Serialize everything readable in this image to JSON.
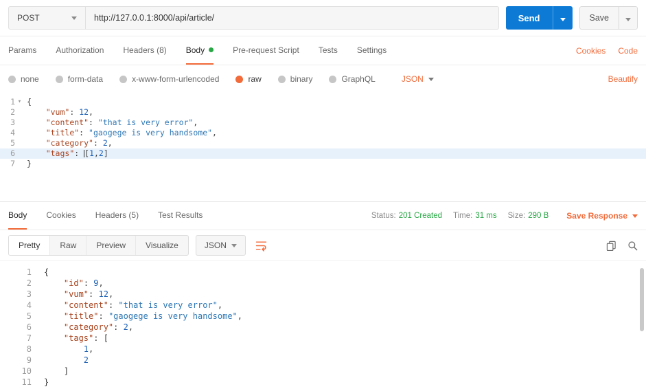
{
  "colors": {
    "orange": "#F26B3A",
    "blue": "#0D7BD6",
    "green": "#28A745"
  },
  "request": {
    "method": "POST",
    "url": "http://127.0.0.1:8000/api/article/",
    "send_label": "Send",
    "save_label": "Save",
    "tabs": [
      {
        "label": "Params"
      },
      {
        "label": "Authorization"
      },
      {
        "label": "Headers (8)"
      },
      {
        "label": "Body"
      },
      {
        "label": "Pre-request Script"
      },
      {
        "label": "Tests"
      },
      {
        "label": "Settings"
      }
    ],
    "links": {
      "cookies": "Cookies",
      "code": "Code"
    },
    "body_types": [
      {
        "label": "none"
      },
      {
        "label": "form-data"
      },
      {
        "label": "x-www-form-urlencoded"
      },
      {
        "label": "raw"
      },
      {
        "label": "binary"
      },
      {
        "label": "GraphQL"
      }
    ],
    "language": "JSON",
    "beautify_label": "Beautify",
    "editor": {
      "active_line": 6,
      "fold_line": 1,
      "lines": [
        [
          {
            "t": "p",
            "v": "{"
          }
        ],
        [
          {
            "t": "w",
            "v": "    "
          },
          {
            "t": "k",
            "v": "\"vum\""
          },
          {
            "t": "p",
            "v": ": "
          },
          {
            "t": "n",
            "v": "12"
          },
          {
            "t": "p",
            "v": ","
          }
        ],
        [
          {
            "t": "w",
            "v": "    "
          },
          {
            "t": "k",
            "v": "\"content\""
          },
          {
            "t": "p",
            "v": ": "
          },
          {
            "t": "s",
            "v": "\"that is very error\""
          },
          {
            "t": "p",
            "v": ","
          }
        ],
        [
          {
            "t": "w",
            "v": "    "
          },
          {
            "t": "k",
            "v": "\"title\""
          },
          {
            "t": "p",
            "v": ": "
          },
          {
            "t": "s",
            "v": "\"gaogege is very handsome\""
          },
          {
            "t": "p",
            "v": ","
          }
        ],
        [
          {
            "t": "w",
            "v": "    "
          },
          {
            "t": "k",
            "v": "\"category\""
          },
          {
            "t": "p",
            "v": ": "
          },
          {
            "t": "n",
            "v": "2"
          },
          {
            "t": "p",
            "v": ","
          }
        ],
        [
          {
            "t": "w",
            "v": "    "
          },
          {
            "t": "k",
            "v": "\"tags\""
          },
          {
            "t": "p",
            "v": ": "
          },
          {
            "t": "cur",
            "v": ""
          },
          {
            "t": "p",
            "v": "["
          },
          {
            "t": "n",
            "v": "1"
          },
          {
            "t": "p",
            "v": ","
          },
          {
            "t": "n",
            "v": "2"
          },
          {
            "t": "p",
            "v": "]"
          }
        ],
        [
          {
            "t": "p",
            "v": "}"
          }
        ]
      ]
    }
  },
  "response": {
    "tabs": [
      {
        "label": "Body"
      },
      {
        "label": "Cookies"
      },
      {
        "label": "Headers (5)"
      },
      {
        "label": "Test Results"
      }
    ],
    "status": {
      "status_label": "Status:",
      "status_value": "201 Created",
      "time_label": "Time:",
      "time_value": "31 ms",
      "size_label": "Size:",
      "size_value": "290 B"
    },
    "save_response_label": "Save Response",
    "views": [
      {
        "label": "Pretty"
      },
      {
        "label": "Raw"
      },
      {
        "label": "Preview"
      },
      {
        "label": "Visualize"
      }
    ],
    "language": "JSON",
    "editor": {
      "active_line": null,
      "fold_line": null,
      "lines": [
        [
          {
            "t": "p",
            "v": "{"
          }
        ],
        [
          {
            "t": "w",
            "v": "    "
          },
          {
            "t": "k",
            "v": "\"id\""
          },
          {
            "t": "p",
            "v": ": "
          },
          {
            "t": "n",
            "v": "9"
          },
          {
            "t": "p",
            "v": ","
          }
        ],
        [
          {
            "t": "w",
            "v": "    "
          },
          {
            "t": "k",
            "v": "\"vum\""
          },
          {
            "t": "p",
            "v": ": "
          },
          {
            "t": "n",
            "v": "12"
          },
          {
            "t": "p",
            "v": ","
          }
        ],
        [
          {
            "t": "w",
            "v": "    "
          },
          {
            "t": "k",
            "v": "\"content\""
          },
          {
            "t": "p",
            "v": ": "
          },
          {
            "t": "s",
            "v": "\"that is very error\""
          },
          {
            "t": "p",
            "v": ","
          }
        ],
        [
          {
            "t": "w",
            "v": "    "
          },
          {
            "t": "k",
            "v": "\"title\""
          },
          {
            "t": "p",
            "v": ": "
          },
          {
            "t": "s",
            "v": "\"gaogege is very handsome\""
          },
          {
            "t": "p",
            "v": ","
          }
        ],
        [
          {
            "t": "w",
            "v": "    "
          },
          {
            "t": "k",
            "v": "\"category\""
          },
          {
            "t": "p",
            "v": ": "
          },
          {
            "t": "n",
            "v": "2"
          },
          {
            "t": "p",
            "v": ","
          }
        ],
        [
          {
            "t": "w",
            "v": "    "
          },
          {
            "t": "k",
            "v": "\"tags\""
          },
          {
            "t": "p",
            "v": ": "
          },
          {
            "t": "p",
            "v": "["
          }
        ],
        [
          {
            "t": "w",
            "v": "        "
          },
          {
            "t": "n",
            "v": "1"
          },
          {
            "t": "p",
            "v": ","
          }
        ],
        [
          {
            "t": "w",
            "v": "        "
          },
          {
            "t": "n",
            "v": "2"
          }
        ],
        [
          {
            "t": "w",
            "v": "    "
          },
          {
            "t": "p",
            "v": "]"
          }
        ],
        [
          {
            "t": "p",
            "v": "}"
          }
        ]
      ]
    }
  }
}
